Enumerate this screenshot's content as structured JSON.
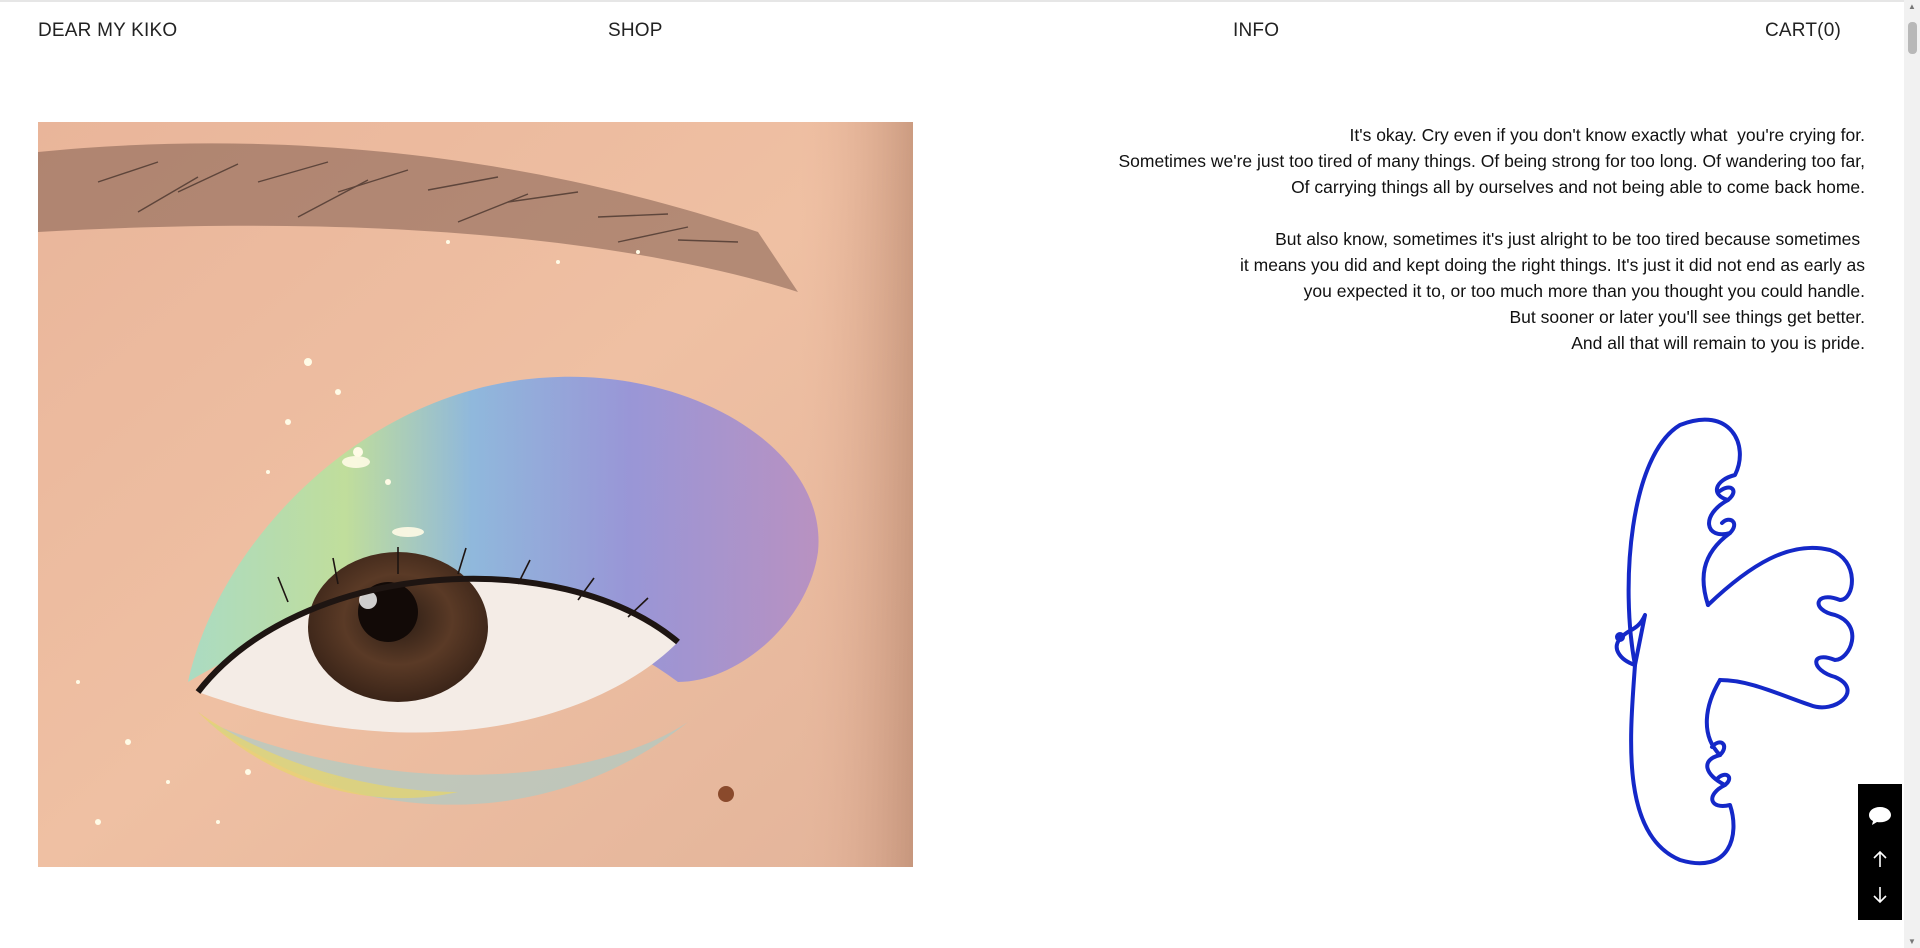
{
  "nav": {
    "logo": "DEAR MY KIKO",
    "shop": "SHOP",
    "info": "INFO",
    "cart": "CART(0)"
  },
  "hero_image": {
    "subject": "close-up eye with pastel rainbow eyeshadow"
  },
  "poem": {
    "lines": [
      "It's okay. Cry even if you don't know exactly what  you're crying for.",
      "Sometimes we're just too tired of many things. Of being strong for too long. Of wandering too far,",
      "Of carrying things all by ourselves and not being able to come back home.",
      "",
      "But also know, sometimes it's just alright to be too tired because sometimes ",
      "it means you did and kept doing the right things. It's just it did not end as early as",
      "you expected it to, or too much more than you thought you could handle.",
      "But sooner or later you'll see things get better.",
      "And all that will remain to you is pride."
    ]
  },
  "dove_illustration": {
    "color": "#1428c8"
  },
  "floating_toolbar": {
    "icons": [
      "chat-icon",
      "arrow-up-icon",
      "arrow-down-icon"
    ],
    "background": "#000000"
  }
}
